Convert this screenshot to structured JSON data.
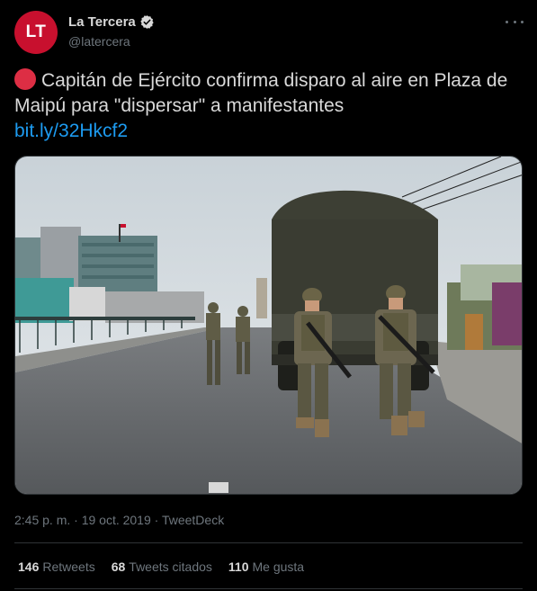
{
  "author": {
    "avatar_text": "LT",
    "display_name": "La Tercera",
    "handle": "@latercera",
    "verified_icon": "verified-badge-icon",
    "brand_color": "#c8102e"
  },
  "tweet": {
    "text": "Capitán de Ejército confirma disparo al aire en Plaza de Maipú para \"dispersar\" a manifestantes",
    "link": "bit.ly/32Hkcf2",
    "leading_icon": "red-circle-icon"
  },
  "media": {
    "description_icon": "photo-soldiers-truck"
  },
  "meta": {
    "timestamp": "2:45 p. m. · 19 oct. 2019 · TweetDeck"
  },
  "stats": [
    {
      "count": "146",
      "label": "Retweets"
    },
    {
      "count": "68",
      "label": "Tweets citados"
    },
    {
      "count": "110",
      "label": "Me gusta"
    }
  ],
  "colors": {
    "background": "#000000",
    "text": "#d9d9d9",
    "secondary": "#6e767d",
    "link": "#1d9bf0",
    "divider": "#2f3336"
  }
}
